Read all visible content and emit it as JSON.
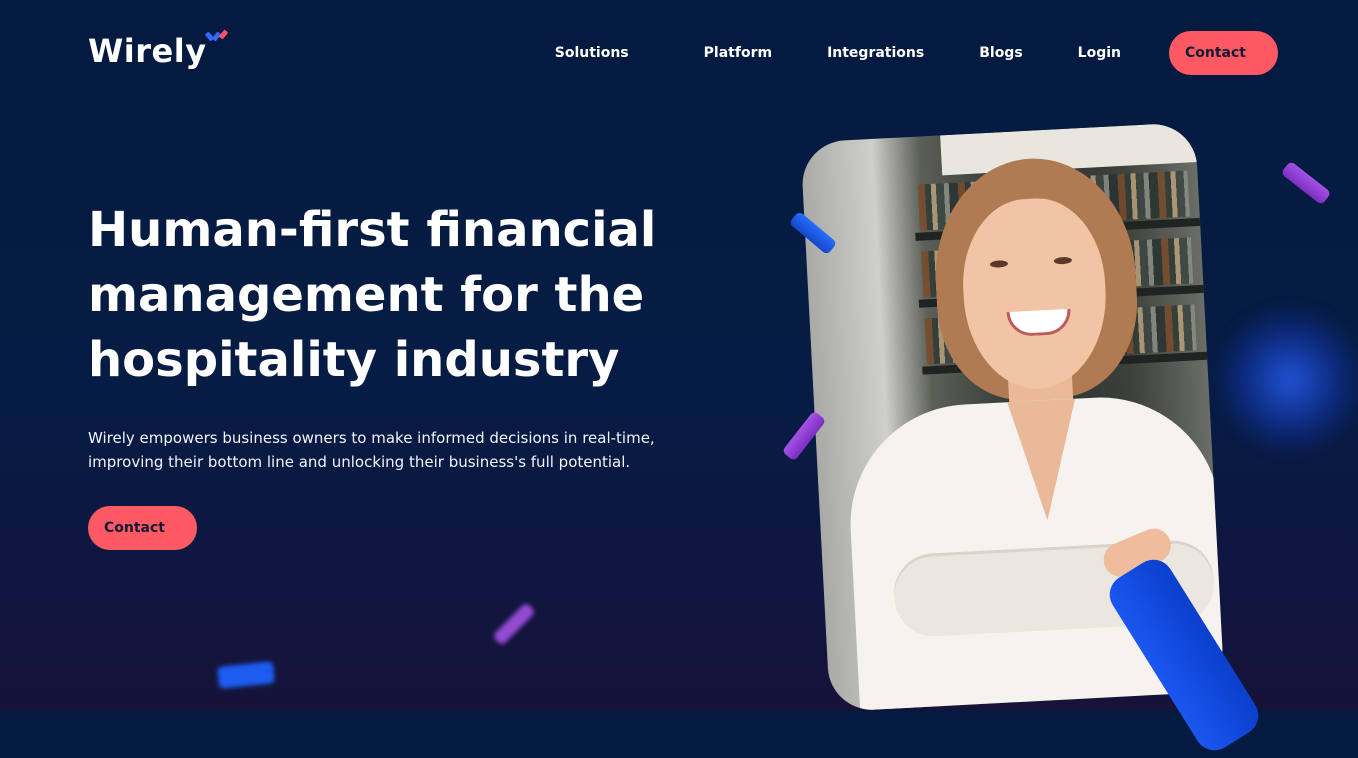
{
  "brand": {
    "name": "Wirely",
    "mark_icon": "checkmark-accent-icon",
    "colors": {
      "mark_blue": "#3568ff",
      "mark_red": "#ff4d63"
    }
  },
  "nav": {
    "items": [
      {
        "label": "Solutions"
      },
      {
        "label": "Platform"
      },
      {
        "label": "Integrations"
      },
      {
        "label": "Blogs"
      },
      {
        "label": "Login"
      }
    ],
    "contact_label": "Contact"
  },
  "hero": {
    "headline": "Human-first financial management for the hospitality industry",
    "subtext": "Wirely empowers business owners to make informed decisions in real-time, improving their bottom line and unlocking their business's full potential.",
    "cta_label": "Contact",
    "image_subject": "smiling woman with crossed arms in a bar"
  },
  "colors": {
    "background": "#041a3f",
    "accent": "#ff5a63",
    "shape_blue": "#1d5cf0",
    "shape_purple": "#a24fe0"
  }
}
